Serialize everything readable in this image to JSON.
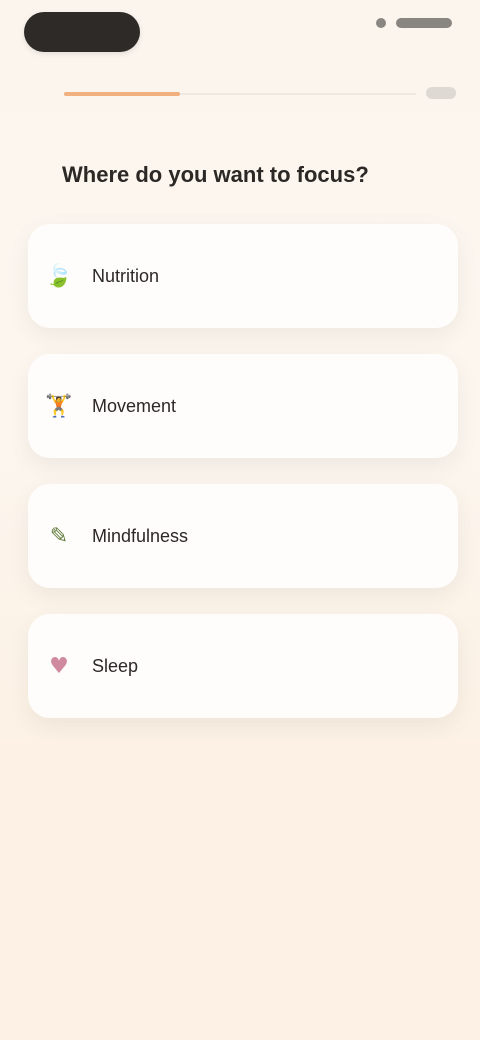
{
  "status_bar": {
    "left_pill": "",
    "right_indicators": ""
  },
  "progress": {
    "value": 0.33
  },
  "question": {
    "title": "Where do you want to focus?"
  },
  "options": [
    {
      "id": "option-1",
      "label": "Nutrition",
      "icon": "leaf-icon",
      "icon_glyph": "🍃",
      "icon_color": "#7bc46f"
    },
    {
      "id": "option-2",
      "label": "Movement",
      "icon": "dumbbell-icon",
      "icon_glyph": "🏋",
      "icon_color": "#9aa2a8"
    },
    {
      "id": "option-3",
      "label": "Mindfulness",
      "icon": "pencil-icon",
      "icon_glyph": "✎",
      "icon_color": "#5f7a3a"
    },
    {
      "id": "option-4",
      "label": "Sleep",
      "icon": "heart-icon",
      "icon_glyph": "♥",
      "icon_color": "#d08aa0"
    }
  ],
  "colors": {
    "background": "#fcf1e4",
    "card": "#fffdfb",
    "accent_progress": "#f1b07d",
    "text_primary": "#2b2825"
  }
}
